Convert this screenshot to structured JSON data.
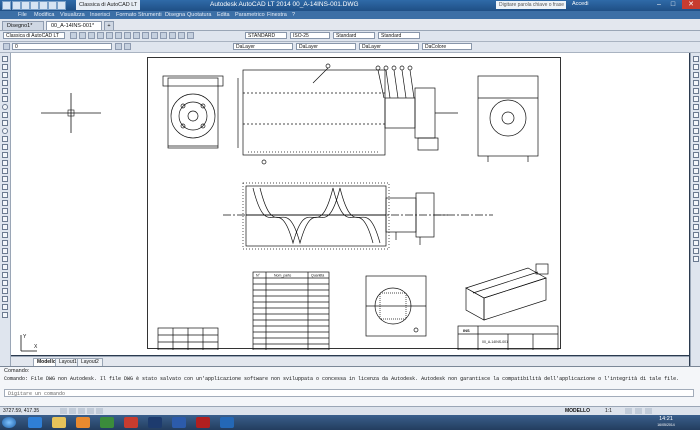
{
  "window": {
    "title": "Autodesk AutoCAD LT 2014  00_A-14INS-001.DWG",
    "workspace": "Classica di AutoCAD LT",
    "search_placeholder": "Digitare parola chiave o frase",
    "user": "Accedi"
  },
  "menu": [
    "File",
    "Modifica",
    "Visualizza",
    "Inserisci",
    "Formato",
    "Strumenti",
    "Disegna",
    "Quotatura",
    "Edita",
    "Parametrico",
    "Finestra",
    "?"
  ],
  "doc_tabs": [
    {
      "label": "Disegno1*",
      "active": false
    },
    {
      "label": "00_A-14INS-001*",
      "active": true
    }
  ],
  "toolbar1": {
    "workspace_combo": "Classica di AutoCAD LT",
    "text_style": "STANDARD",
    "dim_style": "ISO-25",
    "table_style": "Standard",
    "multileader_style": "Standard"
  },
  "toolbar2": {
    "layer": "0",
    "color": "DaLayer",
    "linetype": "DaLayer",
    "lineweight": "DaLayer",
    "plotstyle": "DaColore"
  },
  "layout_tabs": [
    {
      "label": "Modello",
      "active": true
    },
    {
      "label": "Layout1",
      "active": false
    },
    {
      "label": "Layout2",
      "active": false
    }
  ],
  "command": {
    "header": "Comando:",
    "history": [
      "Comando: File DWG non Autodesk. Il file DWG è stato salvato con un'applicazione software non sviluppata o concessa in licenza da Autodesk. Autodesk non garantisce la compatibilità dell'applicazione o l'integrità di tale file."
    ],
    "prompt": "Digitare un comando"
  },
  "status": {
    "coordinates": "3727.59, 417.35",
    "space": "MODELLO",
    "zoom": "1:1"
  },
  "taskbar": {
    "time": "14:21",
    "date": "16/05/2014",
    "apps": [
      "ie",
      "folder",
      "media",
      "excel",
      "autocad",
      "photoshop",
      "word",
      "pdf",
      "outlook"
    ]
  },
  "drawing": {
    "ucs_y": "Y",
    "ucs_x": "X",
    "table_header_item": "N°",
    "table_header_desc": "Nom_parte",
    "table_header_qty": "Quantità",
    "title_block_company": "INS",
    "title_block_code": "00_A-14INS-001"
  },
  "colors": {
    "titlebar": "#1f4f85",
    "drawing_bg": "#ffffff",
    "line": "#111111"
  }
}
